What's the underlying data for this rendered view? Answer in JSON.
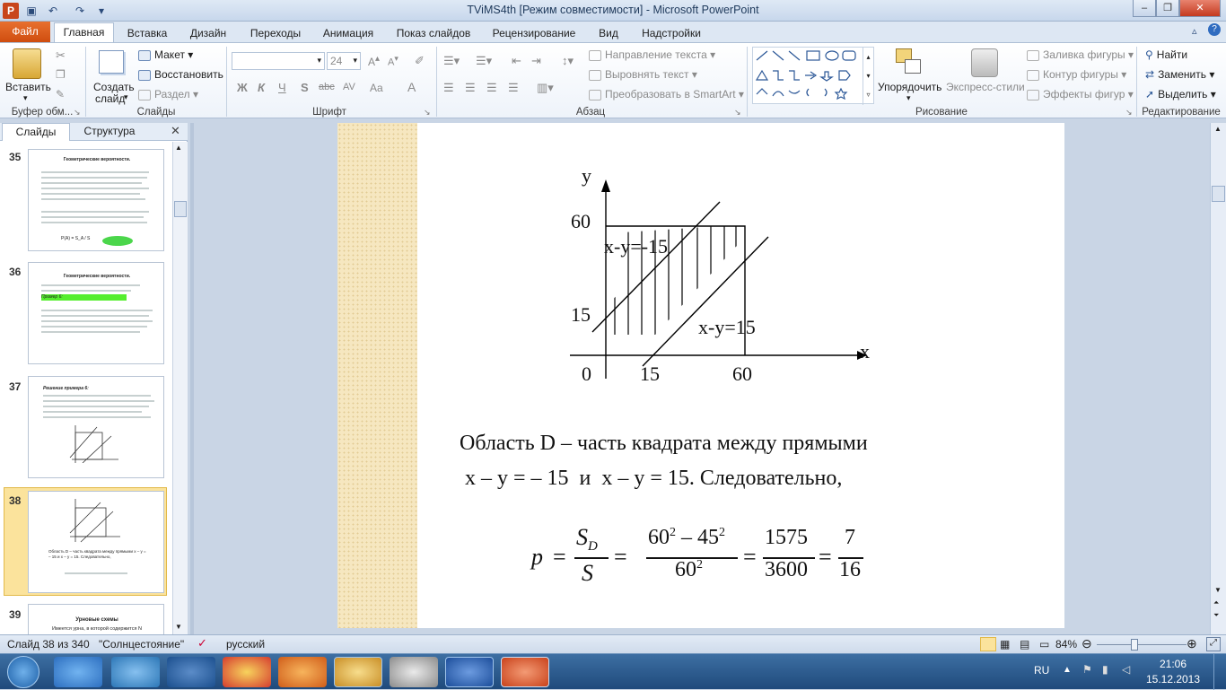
{
  "window": {
    "title": "TViMS4th [Режим совместимости] - Microsoft PowerPoint"
  },
  "tabs": {
    "file": "Файл",
    "items": [
      "Главная",
      "Вставка",
      "Дизайн",
      "Переходы",
      "Анимация",
      "Показ слайдов",
      "Рецензирование",
      "Вид",
      "Надстройки"
    ]
  },
  "ribbon": {
    "clipboard": {
      "paste": "Вставить",
      "label": "Буфер обм..."
    },
    "slides": {
      "new_slide_1": "Создать",
      "new_slide_2": "слайд",
      "layout": "Макет",
      "reset": "Восстановить",
      "section": "Раздел",
      "label": "Слайды"
    },
    "font": {
      "size": "24",
      "bold": "Ж",
      "italic": "К",
      "underline": "Ч",
      "shadow": "S",
      "strike": "abc",
      "spacing": "AV",
      "case": "Aa",
      "color": "A",
      "label": "Шрифт"
    },
    "paragraph": {
      "text_direction": "Направление текста",
      "align_text": "Выровнять текст",
      "smartart": "Преобразовать в SmartArt",
      "label": "Абзац"
    },
    "drawing": {
      "arrange": "Упорядочить",
      "quick_styles": "Экспресс-стили",
      "fill": "Заливка фигуры",
      "outline": "Контур фигуры",
      "effects": "Эффекты фигур",
      "label": "Рисование"
    },
    "editing": {
      "find": "Найти",
      "replace": "Заменить",
      "select": "Выделить",
      "label": "Редактирование"
    }
  },
  "panel": {
    "tab_slides": "Слайды",
    "tab_outline": "Структура",
    "thumbs": [
      {
        "num": "35",
        "title": "Геометрические вероятности.",
        "formula": "P(A) = S_A / S"
      },
      {
        "num": "36",
        "title": "Геометрические вероятности.",
        "example": "Пример 6:"
      },
      {
        "num": "37",
        "title": "Решение примера 6:"
      },
      {
        "num": "38",
        "caption": "Область D – часть квадрата между прямыми x – y = – 15 и x – y = 15. Следовательно,"
      },
      {
        "num": "39",
        "title": "Урновые схемы",
        "line": "Имеется урна, в которой содержится N"
      }
    ]
  },
  "slide": {
    "graph": {
      "axis_y": "y",
      "axis_x": "x",
      "label_60y": "60",
      "label_15y": "15",
      "label_0": "0",
      "label_15x": "15",
      "label_60x": "60",
      "line1": "x-y=-15",
      "line2": "x-y=15"
    },
    "text_line1": "Область D – часть квадрата между прямыми",
    "text_line2": "x – y = – 15  и  x – y = 15. Следовательно,",
    "formula": {
      "p": "p",
      "eq": "=",
      "sd": "S",
      "sd_sub": "D",
      "s": "S",
      "num1": "60",
      "num1_exp": "2",
      "minus": " – 45",
      "num1b_exp": "2",
      "den1": "60",
      "den1_exp": "2",
      "frac2_num": "1575",
      "frac2_den": "3600",
      "frac3_num": "7",
      "frac3_den": "16"
    }
  },
  "status": {
    "slide_info": "Слайд 38 из 340",
    "theme": "\"Солнцестояние\"",
    "language": "русский",
    "zoom": "84%"
  },
  "taskbar": {
    "lang": "RU",
    "time": "21:06",
    "date": "15.12.2013"
  }
}
